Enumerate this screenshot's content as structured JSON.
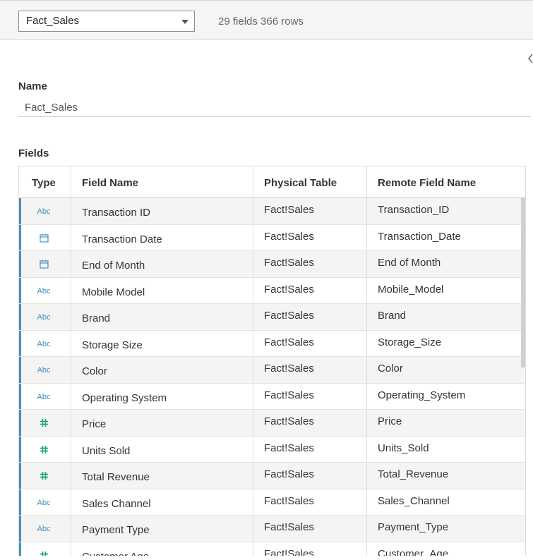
{
  "toolbar": {
    "table_select_value": "Fact_Sales",
    "summary": "29 fields 366 rows"
  },
  "details": {
    "name_label": "Name",
    "name_value": "Fact_Sales",
    "fields_label": "Fields"
  },
  "grid": {
    "columns": [
      "Type",
      "Field Name",
      "Physical Table",
      "Remote Field Name"
    ],
    "rows": [
      {
        "type": "string",
        "type_label": "Abc",
        "field": "Transaction ID",
        "table": "Fact!Sales",
        "remote": "Transaction_ID"
      },
      {
        "type": "date",
        "type_label": "",
        "field": "Transaction Date",
        "table": "Fact!Sales",
        "remote": "Transaction_Date"
      },
      {
        "type": "date",
        "type_label": "",
        "field": "End of Month",
        "table": "Fact!Sales",
        "remote": "End of Month"
      },
      {
        "type": "string",
        "type_label": "Abc",
        "field": "Mobile Model",
        "table": "Fact!Sales",
        "remote": "Mobile_Model"
      },
      {
        "type": "string",
        "type_label": "Abc",
        "field": "Brand",
        "table": "Fact!Sales",
        "remote": "Brand"
      },
      {
        "type": "string",
        "type_label": "Abc",
        "field": "Storage Size",
        "table": "Fact!Sales",
        "remote": "Storage_Size"
      },
      {
        "type": "string",
        "type_label": "Abc",
        "field": "Color",
        "table": "Fact!Sales",
        "remote": "Color"
      },
      {
        "type": "string",
        "type_label": "Abc",
        "field": "Operating System",
        "table": "Fact!Sales",
        "remote": "Operating_System"
      },
      {
        "type": "number",
        "type_label": "",
        "field": "Price",
        "table": "Fact!Sales",
        "remote": "Price"
      },
      {
        "type": "number",
        "type_label": "",
        "field": "Units Sold",
        "table": "Fact!Sales",
        "remote": "Units_Sold"
      },
      {
        "type": "number",
        "type_label": "",
        "field": "Total Revenue",
        "table": "Fact!Sales",
        "remote": "Total_Revenue"
      },
      {
        "type": "string",
        "type_label": "Abc",
        "field": "Sales Channel",
        "table": "Fact!Sales",
        "remote": "Sales_Channel"
      },
      {
        "type": "string",
        "type_label": "Abc",
        "field": "Payment Type",
        "table": "Fact!Sales",
        "remote": "Payment_Type"
      },
      {
        "type": "number",
        "type_label": "",
        "field": "Customer Age",
        "table": "Fact!Sales",
        "remote": "Customer_Age"
      }
    ]
  },
  "colors": {
    "string_icon": "#4a8fc0",
    "date_icon": "#4a8fc0",
    "number_icon": "#1aa37a",
    "row_accent": "#4a8fc0"
  }
}
